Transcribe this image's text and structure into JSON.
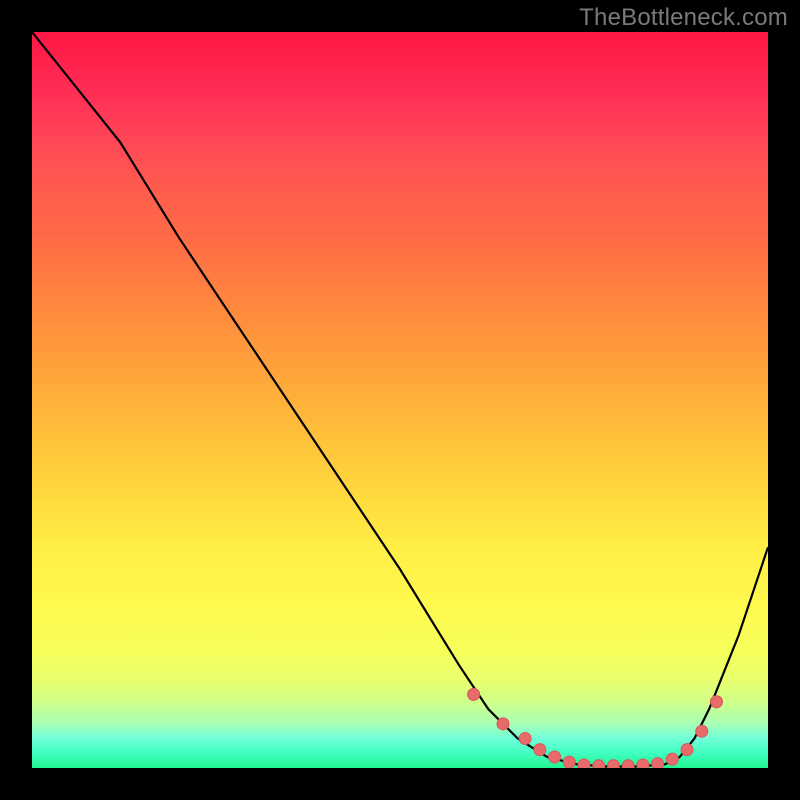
{
  "watermark": "TheBottleneck.com",
  "chart_data": {
    "type": "line",
    "title": "",
    "xlabel": "",
    "ylabel": "",
    "xlim": [
      0,
      100
    ],
    "ylim": [
      0,
      100
    ],
    "curve": {
      "x": [
        0,
        8,
        12,
        20,
        30,
        40,
        50,
        58,
        62,
        66,
        70,
        74,
        78,
        82,
        86,
        88,
        90,
        92,
        96,
        100
      ],
      "y": [
        100,
        90,
        85,
        72,
        57,
        42,
        27,
        14,
        8,
        4,
        1.5,
        0.5,
        0.2,
        0.2,
        0.5,
        1.5,
        4,
        8,
        18,
        30
      ]
    },
    "dots": {
      "x": [
        60,
        64,
        67,
        69,
        71,
        73,
        75,
        77,
        79,
        81,
        83,
        85,
        87,
        89,
        91,
        93
      ],
      "y": [
        10,
        6,
        4,
        2.5,
        1.5,
        0.8,
        0.4,
        0.3,
        0.3,
        0.3,
        0.4,
        0.6,
        1.2,
        2.5,
        5,
        9
      ]
    },
    "colors": {
      "curve": "#000000",
      "dots": "#e86b6b",
      "dots_stroke": "#d95555"
    }
  }
}
